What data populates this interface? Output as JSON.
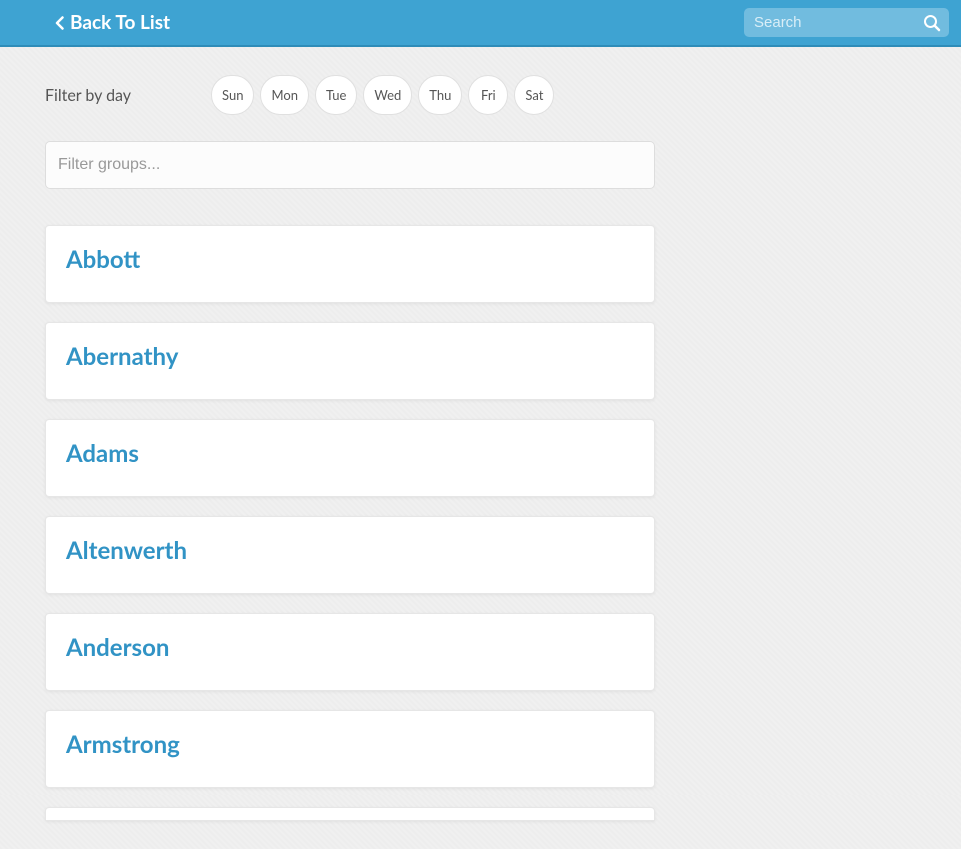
{
  "header": {
    "back_label": "Back To List",
    "search_placeholder": "Search"
  },
  "filter": {
    "label": "Filter by day",
    "days": [
      "Sun",
      "Mon",
      "Tue",
      "Wed",
      "Thu",
      "Fri",
      "Sat"
    ],
    "groups_placeholder": "Filter groups..."
  },
  "groups": [
    {
      "name": "Abbott"
    },
    {
      "name": "Abernathy"
    },
    {
      "name": "Adams"
    },
    {
      "name": "Altenwerth"
    },
    {
      "name": "Anderson"
    },
    {
      "name": "Armstrong"
    }
  ]
}
